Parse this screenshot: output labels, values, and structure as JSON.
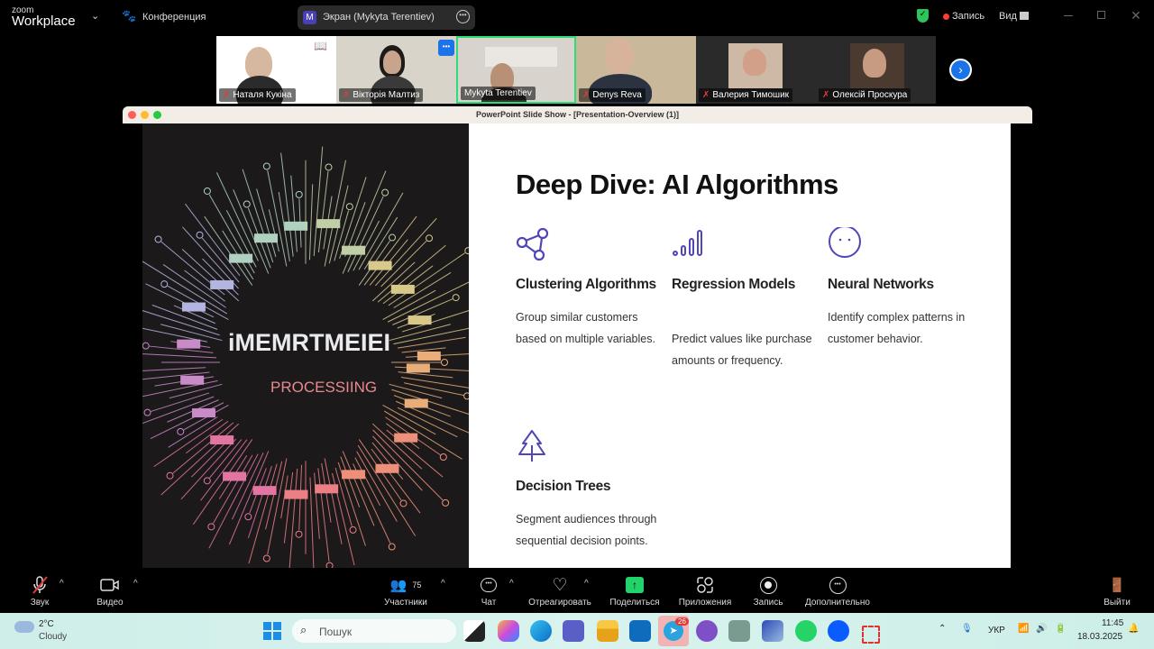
{
  "app": {
    "logo_small": "zoom",
    "logo_big": "Workplace",
    "meeting_label": "Конференция",
    "screen_share": "Экран (Mykyta Terentiev)",
    "screen_badge": "M",
    "record_label": "Запись",
    "view_label": "Вид"
  },
  "participants": [
    {
      "name": "Наталя Кукіна",
      "muted": true
    },
    {
      "name": "Вікторія Малтиз",
      "muted": true
    },
    {
      "name": "Mykyta Terentiev",
      "muted": false,
      "active": true
    },
    {
      "name": "Denys Reva",
      "muted": true
    },
    {
      "name": "Валерия Тимошик",
      "muted": true
    },
    {
      "name": "Олексій Проскура",
      "muted": true
    }
  ],
  "share_window": {
    "title": "PowerPoint Slide Show - [Presentation-Overview (1)]"
  },
  "slide": {
    "title": "Deep Dive: AI Algorithms",
    "art_text": [
      "iMEMRTMEIEI",
      "PROCESSIING"
    ],
    "accent": "#4f46b8",
    "cards": [
      {
        "icon": "share-nodes-icon",
        "title": "Clustering Algorithms",
        "text": "Group similar customers based on multiple variables."
      },
      {
        "icon": "signal-bars-icon",
        "title": "Regression Models",
        "text": "Predict values like purchase amounts or frequency."
      },
      {
        "icon": "neural-face-icon",
        "title": "Neural Networks",
        "text": "Identify complex patterns in customer behavior."
      },
      {
        "icon": "tree-icon",
        "title": "Decision Trees",
        "text": "Segment audiences through sequential decision points."
      }
    ]
  },
  "toolbar": {
    "audio": "Звук",
    "video": "Видео",
    "participants": "Участники",
    "participants_count": "75",
    "chat": "Чат",
    "react": "Отреагировать",
    "share": "Поделиться",
    "apps": "Приложения",
    "record": "Запись",
    "more": "Дополнительно",
    "leave": "Выйти",
    "share_color": "#22d36b"
  },
  "taskbar": {
    "temp": "2°C",
    "weather": "Cloudy",
    "search_placeholder": "Пошук",
    "telegram_badge": "26",
    "lang": "УКР",
    "time": "11:45",
    "date": "18.03.2025"
  }
}
